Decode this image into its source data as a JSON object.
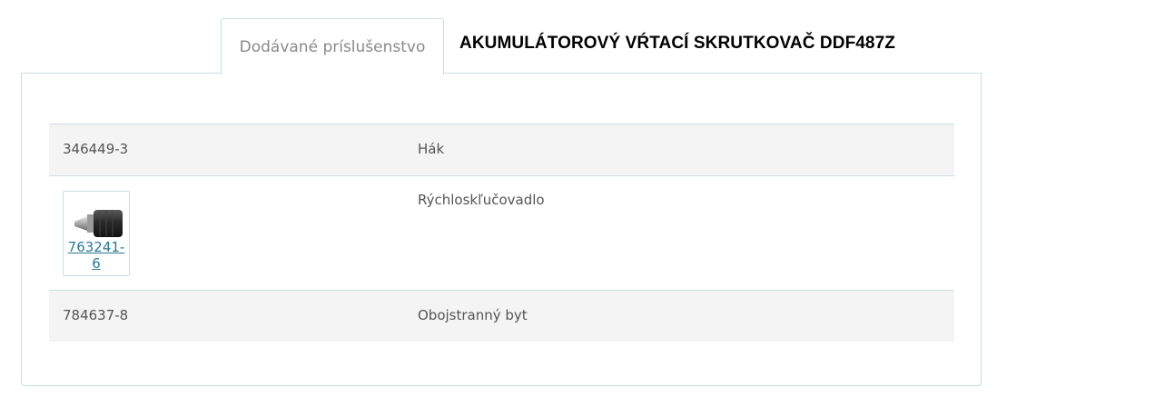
{
  "tabs": {
    "active_label": "Dodávané príslušenstvo"
  },
  "product": {
    "title": "AKUMULÁTOROVÝ VŔTACÍ SKRUTKOVAČ DDF487Z"
  },
  "accessories": [
    {
      "code": "346449-3",
      "name": "Hák"
    },
    {
      "code": "763241-6",
      "name": "Rýchloskľučovadlo",
      "image_icon": "keyless-chuck-icon",
      "link": "763241-6"
    },
    {
      "code": "784637-8",
      "name": "Obojstranný byt"
    }
  ],
  "colors": {
    "border": "#c9dde4",
    "row_shade": "#f4f4f4",
    "link": "#2a7a93"
  }
}
